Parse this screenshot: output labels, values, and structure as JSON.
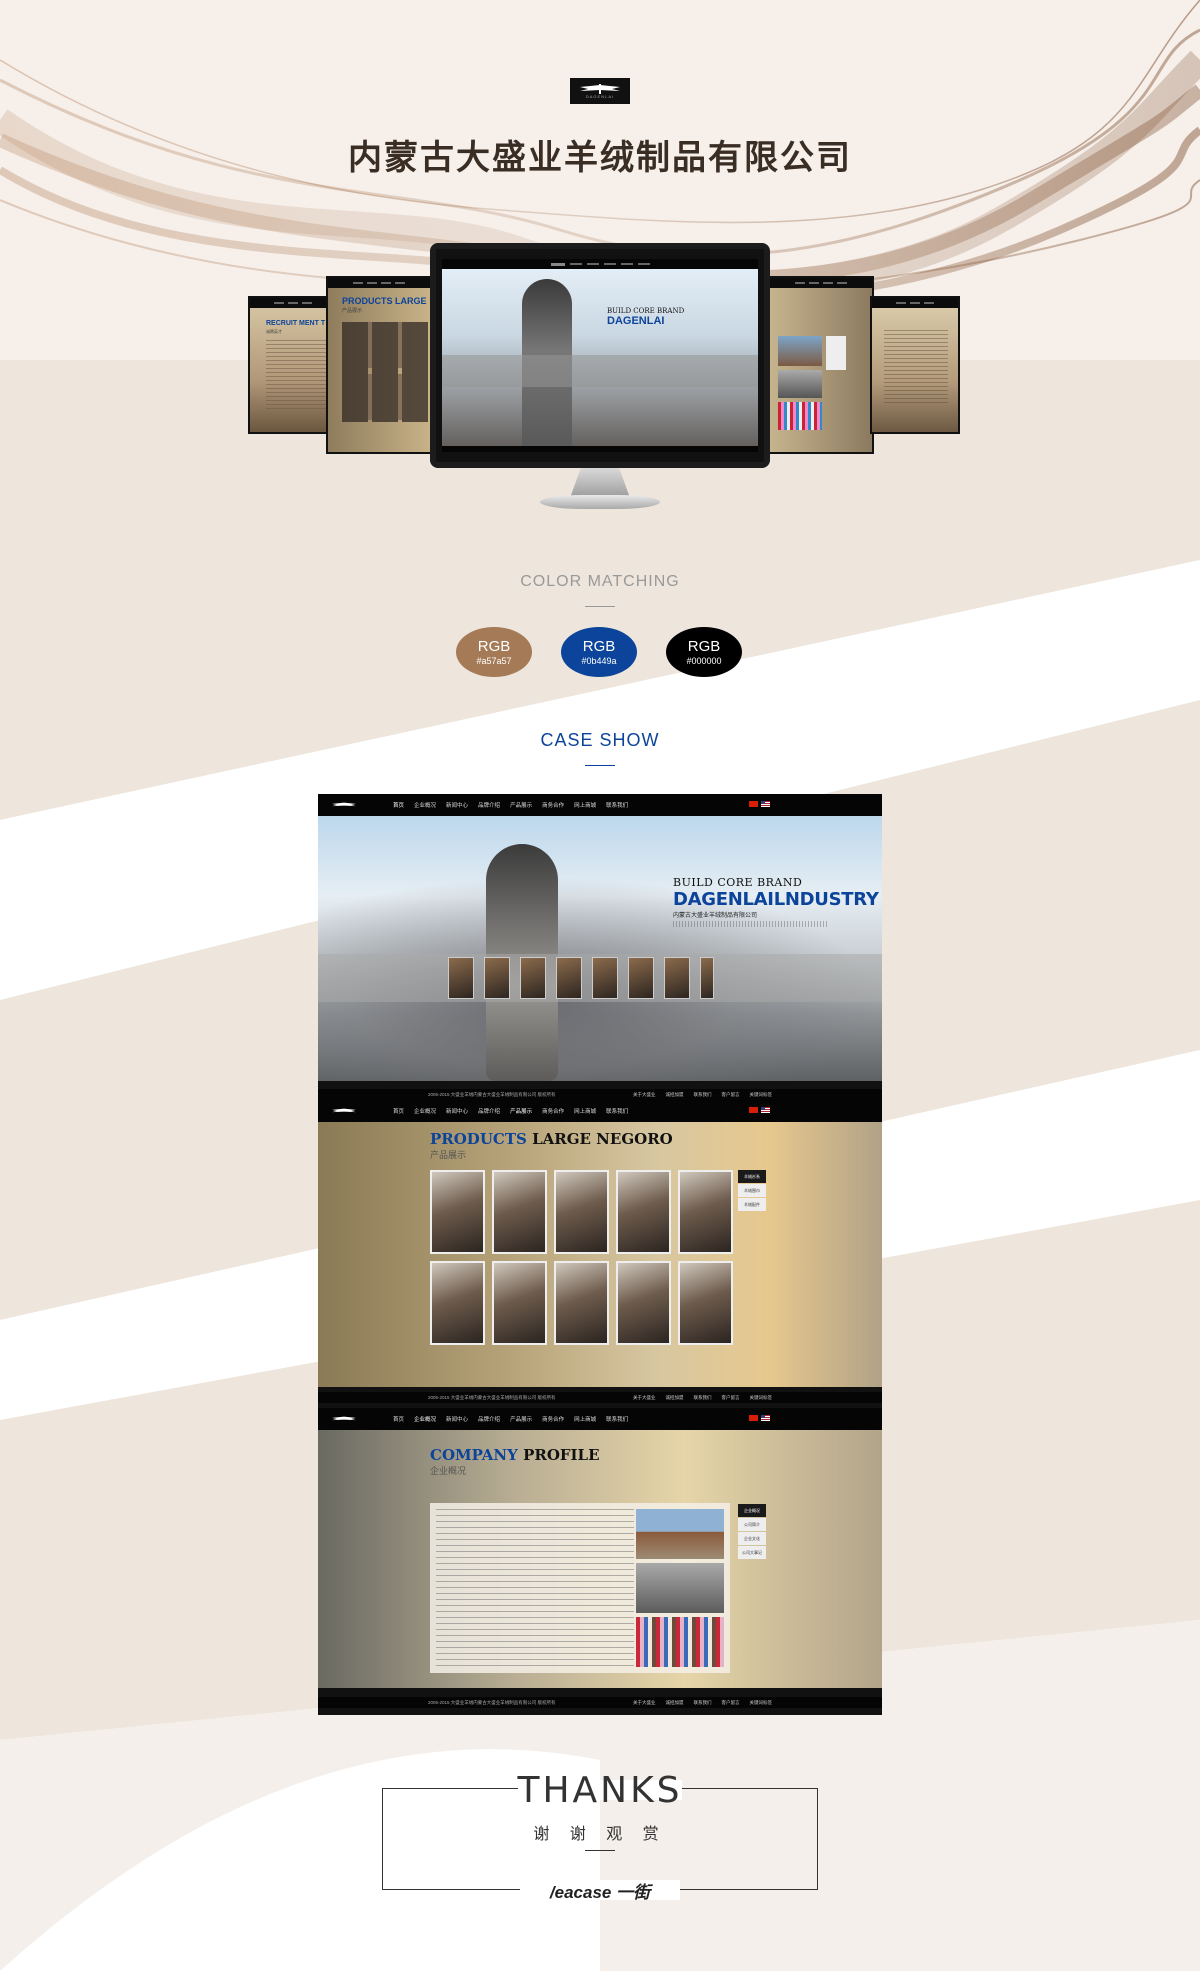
{
  "brand": {
    "logo_text": "DAGENLAI",
    "company_title": "内蒙古大盛业羊绒制品有限公司"
  },
  "colors": {
    "bg_band": "#eee5dc",
    "title_color": "#3a2d24"
  },
  "color_matching": {
    "title": "COLOR  MATCHING",
    "swatches": [
      {
        "label": "RGB",
        "hex_text": "#a57a57",
        "color": "#a57a57"
      },
      {
        "label": "RGB",
        "hex_text": "#0b449a",
        "color": "#0b449a"
      },
      {
        "label": "RGB",
        "hex_text": "#000000",
        "color": "#000000"
      }
    ]
  },
  "case_show": {
    "title": "CASE SHOW"
  },
  "site": {
    "nav": [
      "首页",
      "企业概况",
      "新闻中心",
      "品牌介绍",
      "产品展示",
      "商务合作",
      "网上商城",
      "联系我们"
    ],
    "footer_copy": "2005-2015 大盛业羊绒内蒙古大盛业羊绒制品有限公司 版权所有",
    "footer_links": [
      "关于大盛业",
      "诚招加盟",
      "联系我们",
      "客户留言",
      "关键词标签"
    ],
    "hero": {
      "line1": "BUILD CORE BRAND",
      "line2a": "DAGENLAI",
      "line2b": "LNDUSTRY",
      "line3": "内蒙古大盛业羊绒制品有限公司"
    },
    "products": {
      "title_a": "PRODUCTS ",
      "title_b": "LARGE NEGORO",
      "subtitle": "产品展示",
      "menu": [
        "羊绒衫系",
        "羊绒围巾",
        "羊绒配件"
      ]
    },
    "company": {
      "title_a": "COMPANY ",
      "title_b": "PROFILE",
      "subtitle": "企业概况",
      "menu": [
        "企业概况",
        "公司简介",
        "企业文化",
        "公司大事记"
      ]
    },
    "side_titles": {
      "recruit": "RECRUIT MENT T",
      "recruit_cn": "诚聘英才",
      "products_short": "PRODUCTS LARGE",
      "products_short_cn": "产品展示"
    }
  },
  "thanks": {
    "title": "THANKS",
    "subtitle": "谢 谢 观 赏",
    "signature": "/eacase 一街"
  }
}
